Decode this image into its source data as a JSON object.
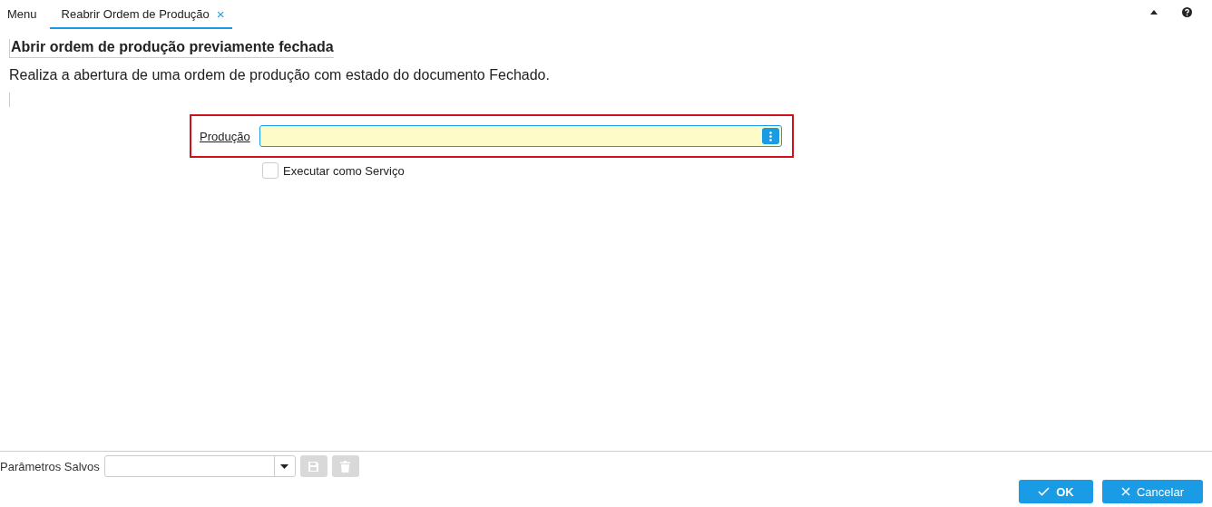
{
  "tabs": [
    {
      "label": "Menu",
      "selected": false,
      "closable": false
    },
    {
      "label": "Reabrir Ordem de Produção",
      "selected": true,
      "closable": true
    }
  ],
  "close_glyph": "×",
  "title": "Abrir ordem de produção previamente fechada",
  "description": "Realiza a abertura de uma ordem de produção com estado do documento Fechado.",
  "field": {
    "label": "Produção",
    "highlighted": true
  },
  "checkbox": {
    "label": "Executar como Serviço",
    "checked": false
  },
  "saved_params": {
    "label": "Parâmetros Salvos",
    "save_disabled": true,
    "delete_disabled": true
  },
  "buttons": [
    {
      "label": "OK",
      "kind": "ok"
    },
    {
      "label": "Cancelar",
      "kind": "cancel"
    }
  ]
}
